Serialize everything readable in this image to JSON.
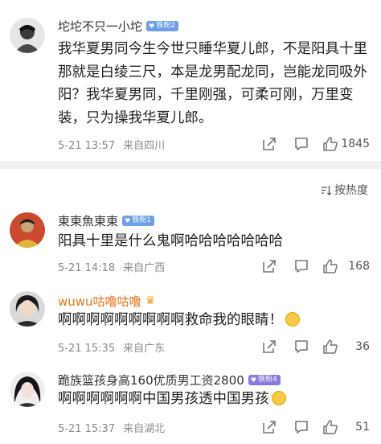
{
  "sort": {
    "label": "按热度",
    "icon": "sort-icon"
  },
  "comments": [
    {
      "username": "坨坨不只一小坨",
      "badge": "铁粉2",
      "badge_color": "#6d9ee8",
      "text": "我华夏男同今生今世只睡华夏儿郎，不是阳具十里那就是白绫三尺，本是龙男配龙同，岂能龙同吸外阳？我华夏男同，千里刚强，可柔可刚，万里变装，只为操我华夏儿郎。",
      "date": "5-21 13:57",
      "location": "来自四川",
      "likes": "1845"
    },
    {
      "username": "東東魚東東",
      "badge": "铁粉1",
      "badge_color": "#6d9ee8",
      "text": "阳具十里是什么鬼啊哈哈哈哈哈哈哈",
      "date": "5-21 14:18",
      "location": "来自广西",
      "likes": "168"
    },
    {
      "username": "wuwu咕噜咕噜",
      "badge_icon": "crown-icon",
      "text": "啊啊啊啊啊啊啊啊啊救命我的眼睛！",
      "text_emoji": "crying-face-emoji",
      "date": "5-21 15:35",
      "location": "来自广东",
      "likes": "36"
    },
    {
      "username": "跪族篮孩身高160优质男工资2800",
      "badge": "铁粉4",
      "badge_color": "#8a79e0",
      "text": "啊啊啊啊啊啊中国男孩透中国男孩",
      "text_emoji": "flushed-face-emoji",
      "date": "5-21 15:37",
      "location": "来自湖北",
      "likes": "51"
    }
  ],
  "colors": {
    "orange_username": "#e8731a",
    "meta_gray": "#8a8a8a",
    "divider": "#f2f2f2"
  }
}
